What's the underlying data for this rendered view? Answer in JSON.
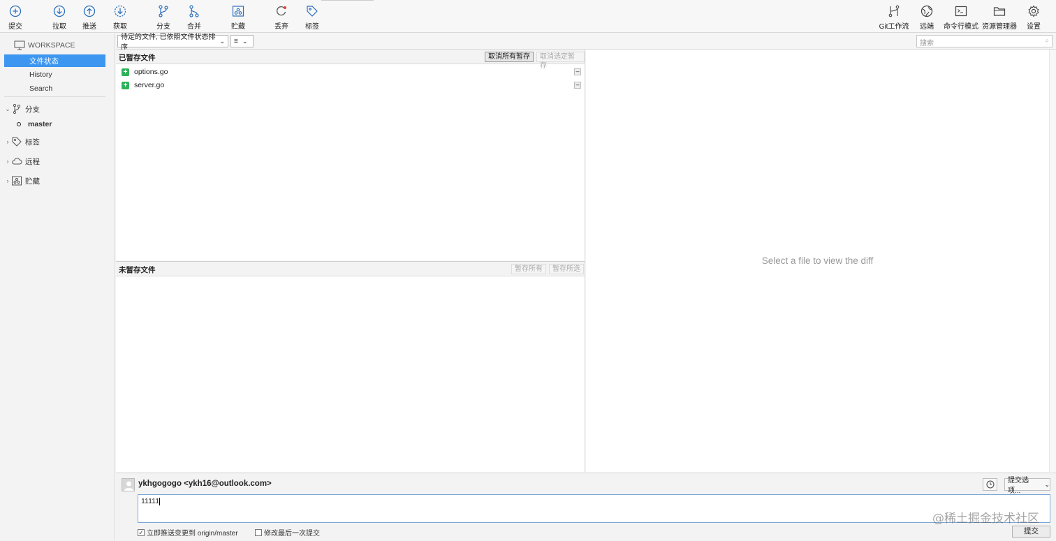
{
  "toolbar": {
    "left": [
      {
        "key": "commit",
        "label": "提交",
        "icon": "commit-icon"
      },
      {
        "key": "pull",
        "label": "拉取",
        "icon": "pull-icon"
      },
      {
        "key": "push",
        "label": "推送",
        "icon": "push-icon"
      },
      {
        "key": "fetch",
        "label": "获取",
        "icon": "fetch-icon"
      },
      {
        "key": "branch",
        "label": "分支",
        "icon": "branch-icon"
      },
      {
        "key": "merge",
        "label": "合并",
        "icon": "merge-icon"
      },
      {
        "key": "stash",
        "label": "贮藏",
        "icon": "stash-icon"
      },
      {
        "key": "discard",
        "label": "丢弃",
        "icon": "discard-icon"
      },
      {
        "key": "tag",
        "label": "标签",
        "icon": "tag-icon"
      }
    ],
    "right": [
      {
        "key": "gitflow",
        "label": "Git工作流",
        "icon": "gitflow-icon"
      },
      {
        "key": "remote",
        "label": "远端",
        "icon": "globe-icon"
      },
      {
        "key": "terminal",
        "label": "命令行模式",
        "icon": "terminal-icon"
      },
      {
        "key": "explorer",
        "label": "资源管理器",
        "icon": "folder-icon"
      },
      {
        "key": "settings",
        "label": "设置",
        "icon": "gear-icon"
      }
    ]
  },
  "sidebar": {
    "workspace_label": "WORKSPACE",
    "workspace_items": [
      "文件状态",
      "History",
      "Search"
    ],
    "selected_index": 0,
    "branches_label": "分支",
    "current_branch": "master",
    "tags_label": "标签",
    "remotes_label": "远程",
    "stashes_label": "贮藏"
  },
  "filter": {
    "sort_label": "待定的文件, 已依照文件状态排序",
    "view_label": "≡",
    "search_placeholder": "搜索"
  },
  "staged": {
    "title": "已暂存文件",
    "unstage_all": "取消所有暂存",
    "unstage_selected": "取消选定暂存",
    "files": [
      "options.go",
      "server.go"
    ]
  },
  "unstaged": {
    "title": "未暂存文件",
    "stage_all": "暂存所有",
    "stage_selected": "暂存所选",
    "files": []
  },
  "diff": {
    "empty_message": "Select a file to view the diff"
  },
  "commit": {
    "author": "ykhgogogo <ykh16@outlook.com>",
    "message": "11111",
    "push_immediately": "立即推送变更到 origin/master",
    "push_checked": true,
    "amend_last": "修改最后一次提交",
    "amend_checked": false,
    "options_label": "提交选项...",
    "submit_label": "提交"
  },
  "watermark": "@稀土掘金技术社区",
  "colors": {
    "selection": "#3d96f0",
    "added": "#2fb15b",
    "discard_dot": "#e0402f"
  }
}
